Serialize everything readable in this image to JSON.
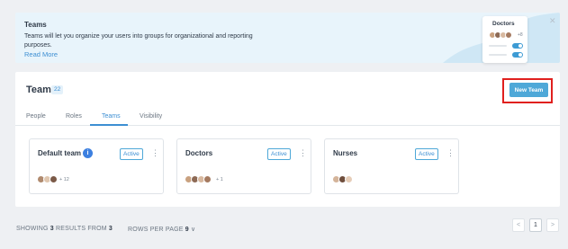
{
  "banner": {
    "title": "Teams",
    "description": "Teams will let you organize your users into groups for organizational and reporting purposes.",
    "link": "Read More",
    "close_icon": "close-icon",
    "illustration": {
      "card_title": "Doctors",
      "count": "+8"
    }
  },
  "header": {
    "title": "Team",
    "count": "22",
    "new_team_label": "New Team"
  },
  "tabs": [
    {
      "label": "People",
      "active": false
    },
    {
      "label": "Roles",
      "active": false
    },
    {
      "label": "Teams",
      "active": true
    },
    {
      "label": "Visibility",
      "active": false
    }
  ],
  "cards": [
    {
      "name": "Default team",
      "status": "Active",
      "info_icon": "i",
      "member_count": "+ 12",
      "menu": "⋮"
    },
    {
      "name": "Doctors",
      "status": "Active",
      "member_count": "+ 1",
      "menu": "⋮"
    },
    {
      "name": "Nurses",
      "status": "Active",
      "member_count": "",
      "menu": "⋮"
    }
  ],
  "footer": {
    "showing_prefix": "SHOWING",
    "shown": "3",
    "results_from": "RESULTS FROM",
    "total": "3",
    "rows_per_page_label": "ROWS PER PAGE",
    "rows_per_page_value": "9",
    "chevron": "∨",
    "prev": "<",
    "current_page": "1",
    "next": ">"
  },
  "colors": {
    "accent": "#3d8fd3",
    "button": "#4ea8d8",
    "highlight": "#e0201e",
    "banner_bg": "#e8f4fb"
  }
}
